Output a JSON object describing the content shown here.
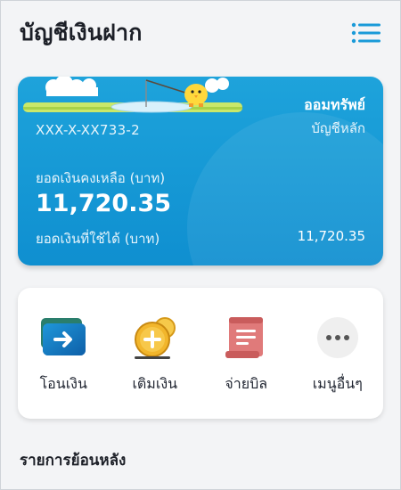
{
  "header": {
    "title": "บัญชีเงินฝาก",
    "menu_icon": "hamburger-menu-icon"
  },
  "account": {
    "type": "ออมทรัพย์",
    "subtype": "บัญชีหลัก",
    "number": "XXX-X-XX733-2",
    "balance_label": "ยอดเงินคงเหลือ (บาท)",
    "balance": "11,720.35",
    "available_label": "ยอดเงินที่ใช้ได้ (บาท)",
    "available": "11,720.35"
  },
  "actions": [
    {
      "label": "โอนเงิน",
      "icon": "transfer-icon"
    },
    {
      "label": "เติมเงิน",
      "icon": "top-up-coin-icon"
    },
    {
      "label": "จ่ายบิล",
      "icon": "bill-scroll-icon"
    },
    {
      "label": "เมนูอื่นๆ",
      "icon": "more-dots-icon"
    }
  ],
  "section": {
    "title": "รายการย้อนหลัง"
  },
  "colors": {
    "card": "#1597d6",
    "accent": "#1a9ad8",
    "coin": "#f2b62c",
    "bill": "#e07a7a"
  }
}
